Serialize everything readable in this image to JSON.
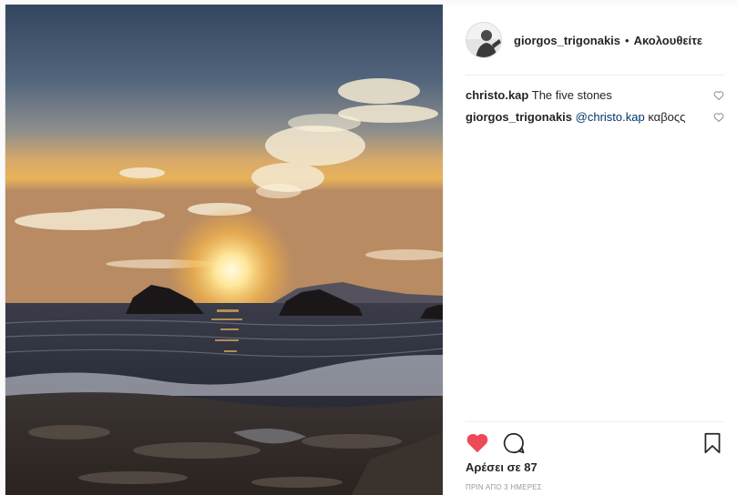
{
  "post": {
    "author": {
      "username": "giorgos_trigonakis",
      "separator": "•",
      "follow_status": "Ακολουθείτε"
    },
    "comments": [
      {
        "username": "christo.kap",
        "mention": "",
        "text": "The five stones"
      },
      {
        "username": "giorgos_trigonakis",
        "mention": "@christo.kap",
        "text": "καβοςς"
      }
    ],
    "likes": "Αρέσει σε 87",
    "timestamp": "ΠΡΙΝ ΑΠΟ 3 ΗΜΕΡΕΣ"
  },
  "icons": {
    "like": "heart-filled-icon",
    "comment": "comment-bubble-icon",
    "save": "bookmark-icon",
    "comment_like": "heart-outline-icon"
  },
  "colors": {
    "like_red": "#ed4956",
    "mention_blue": "#003569",
    "meta_gray": "#999999"
  }
}
